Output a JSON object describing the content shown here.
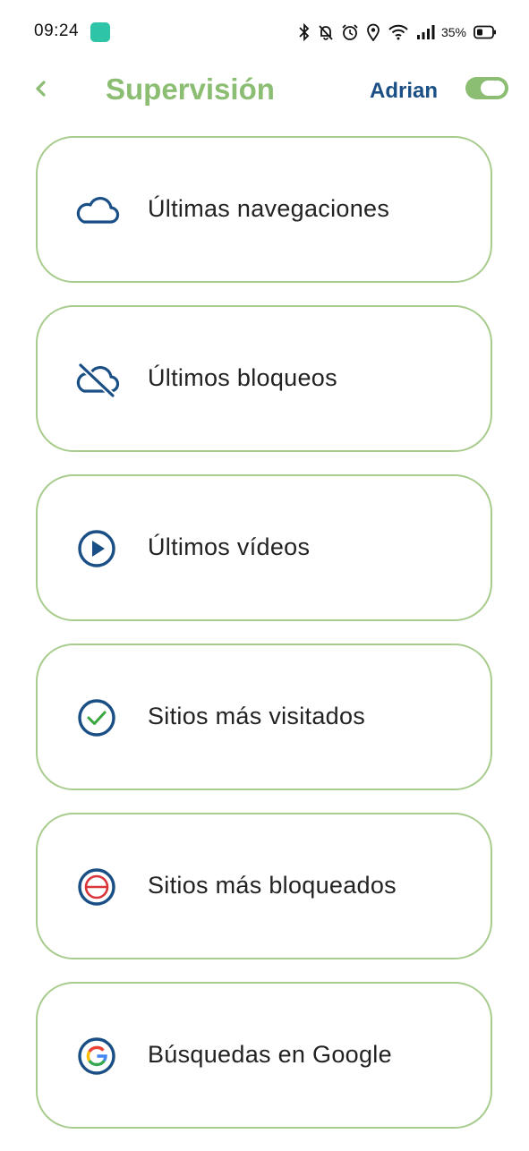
{
  "status_bar": {
    "time": "09:24",
    "battery_percent": "35%",
    "icons": [
      "bluetooth-icon",
      "bell-off-icon",
      "alarm-icon",
      "location-icon",
      "wifi-icon",
      "signal-icon",
      "battery-icon"
    ]
  },
  "header": {
    "title": "Supervisión",
    "user": "Adrian",
    "back_icon": "chevron-left-icon",
    "toggle_on": true
  },
  "colors": {
    "accent_green": "#8bbd72",
    "card_border": "#a8cc8e",
    "brand_blue": "#1a4f86",
    "blocked_red": "#d9343a"
  },
  "menu": [
    {
      "label": "Últimas navegaciones",
      "icon": "cloud-icon"
    },
    {
      "label": "Últimos bloqueos",
      "icon": "cloud-off-icon"
    },
    {
      "label": "Últimos vídeos",
      "icon": "play-circle-icon"
    },
    {
      "label": "Sitios más visitados",
      "icon": "check-circle-icon"
    },
    {
      "label": "Sitios más bloqueados",
      "icon": "blocked-circle-icon"
    },
    {
      "label": "Búsquedas en Google",
      "icon": "google-icon"
    }
  ]
}
